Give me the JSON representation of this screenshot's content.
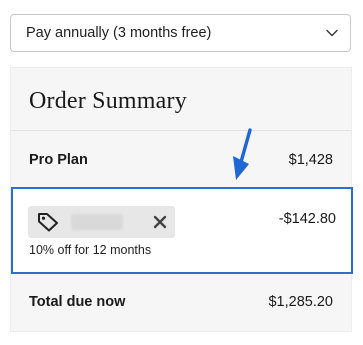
{
  "billing": {
    "selected": "Pay annually (3 months free)"
  },
  "summary": {
    "title": "Order Summary",
    "plan": {
      "label": "Pro Plan",
      "price": "$1,428"
    },
    "discount": {
      "amount": "-$142.80",
      "note": "10% off for 12 months"
    },
    "total": {
      "label": "Total due now",
      "amount": "$1,285.20"
    }
  },
  "icons": {
    "coupon": "tag-icon",
    "remove": "close-icon",
    "dropdown": "chevron-down-icon",
    "annotation": "arrow-down-icon"
  },
  "colors": {
    "highlight_border": "#2b6fd1",
    "annotation_arrow": "#1f66d6"
  }
}
